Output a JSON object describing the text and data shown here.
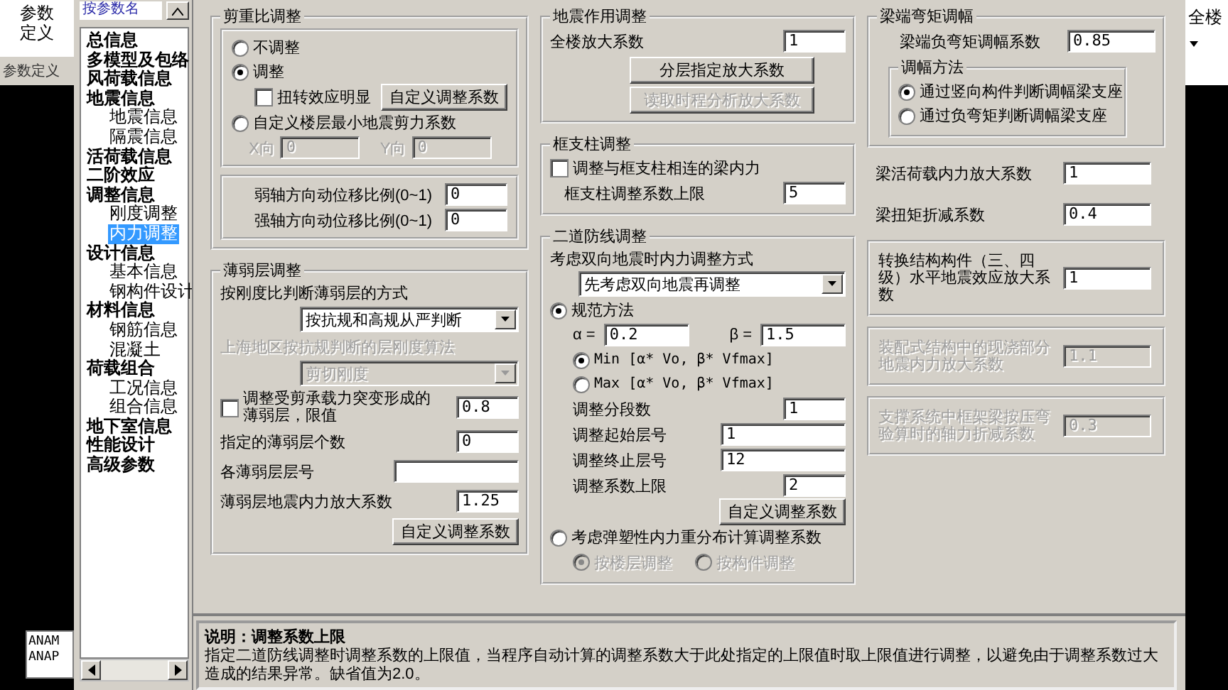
{
  "side": {
    "tab_label": "参数定义",
    "panel_title": "参数定义",
    "console_lines": [
      "ANAM",
      "ANAP"
    ]
  },
  "search": {
    "placeholder": "按参数名"
  },
  "tree": [
    {
      "label": "总信息",
      "selected": false
    },
    {
      "label": "多模型及包络",
      "selected": false
    },
    {
      "label": "风荷载信息",
      "selected": false
    },
    {
      "label": "地震信息",
      "selected": false,
      "children": [
        {
          "label": "地震信息",
          "selected": false
        },
        {
          "label": "隔震信息",
          "selected": false
        }
      ]
    },
    {
      "label": "活荷载信息",
      "selected": false
    },
    {
      "label": "二阶效应",
      "selected": false
    },
    {
      "label": "调整信息",
      "selected": false,
      "children": [
        {
          "label": "刚度调整",
          "selected": false
        },
        {
          "label": "内力调整",
          "selected": true
        }
      ]
    },
    {
      "label": "设计信息",
      "selected": false,
      "children": [
        {
          "label": "基本信息",
          "selected": false
        },
        {
          "label": "钢构件设计",
          "selected": false
        }
      ]
    },
    {
      "label": "材料信息",
      "selected": false,
      "children": [
        {
          "label": "钢筋信息",
          "selected": false
        },
        {
          "label": "混凝土",
          "selected": false
        }
      ]
    },
    {
      "label": "荷载组合",
      "selected": false,
      "children": [
        {
          "label": "工况信息",
          "selected": false
        },
        {
          "label": "组合信息",
          "selected": false
        }
      ]
    },
    {
      "label": "地下室信息",
      "selected": false
    },
    {
      "label": "性能设计",
      "selected": false
    },
    {
      "label": "高级参数",
      "selected": false
    }
  ],
  "shear_ratio": {
    "title": "剪重比调整",
    "options": [
      {
        "label": "不调整",
        "selected": false
      },
      {
        "label": "调整",
        "selected": true
      },
      {
        "label": "自定义楼层最小地震剪力系数",
        "selected": false
      }
    ],
    "torsion": {
      "label": "扭转效应明显",
      "checked": false
    },
    "custom_button": "自定义调整系数",
    "custom_fields": [
      {
        "label": "X向",
        "value": "0",
        "disabled": true
      },
      {
        "label": "Y向",
        "value": "0",
        "disabled": true
      }
    ],
    "ratios": [
      {
        "label": "弱轴方向动位移比例(0~1)",
        "value": "0"
      },
      {
        "label": "强轴方向动位移比例(0~1)",
        "value": "0"
      }
    ]
  },
  "weak_story": {
    "title": "薄弱层调整",
    "method_label": "按刚度比判断薄弱层的方式",
    "method_select": "按抗规和高规从严判断",
    "shanghai_label": {
      "text": "上海地区按抗规判断的层刚度算法",
      "disabled": true
    },
    "shanghai_select": {
      "value": "剪切刚度",
      "disabled": true
    },
    "shear_limit": {
      "label": "调整受剪承载力突变形成的薄弱层，限值",
      "checked": false,
      "value": "0.8"
    },
    "fields": [
      {
        "label": "指定的薄弱层个数",
        "value": "0",
        "kind": "short"
      },
      {
        "label": "各薄弱层层号",
        "kind": "long"
      },
      {
        "label": "薄弱层地震内力放大系数",
        "value": "1.25",
        "kind": "short"
      }
    ],
    "custom_button": "自定义调整系数"
  },
  "seismic": {
    "title": "地震作用调整",
    "field": {
      "label": "全楼放大系数",
      "value": "1"
    },
    "buttons": [
      {
        "label": "分层指定放大系数",
        "disabled": false
      },
      {
        "label": "读取时程分析放大系数",
        "disabled": true
      }
    ]
  },
  "frame_column": {
    "title": "框支柱调整",
    "check": {
      "label": "调整与框支柱相连的梁内力",
      "checked": false
    },
    "field": {
      "label": "框支柱调整系数上限",
      "value": "5"
    }
  },
  "second_defense": {
    "title": "二道防线调整",
    "mode_label": "考虑双向地震时内力调整方式",
    "mode_select": "先考虑双向地震再调整",
    "code_method": {
      "label": "规范方法",
      "selected": true
    },
    "alpha": {
      "label": "α =",
      "value": "0.2"
    },
    "beta": {
      "label": "β =",
      "value": "1.5"
    },
    "formula_options": [
      {
        "label": "Min [α* Vo, β* Vfmax]",
        "selected": true
      },
      {
        "label": "Max [α* Vo, β* Vfmax]",
        "selected": false
      }
    ],
    "fields": [
      {
        "label": "调整分段数",
        "value": "1",
        "kind": "short"
      },
      {
        "label": "调整起始层号",
        "value": "1",
        "kind": "long"
      },
      {
        "label": "调整终止层号",
        "value": "12",
        "kind": "long"
      },
      {
        "label": "调整系数上限",
        "value": "2",
        "kind": "short"
      }
    ],
    "custom_button": "自定义调整系数",
    "plastic_method": {
      "label": "考虑弹塑性内力重分布计算调整系数",
      "selected": false
    },
    "plastic_options": [
      {
        "label": "按楼层调整",
        "selected": true,
        "disabled": true
      },
      {
        "label": "按构件调整",
        "selected": false,
        "disabled": true
      }
    ]
  },
  "beam_moment": {
    "title": "梁端弯矩调幅",
    "field": {
      "label": "梁端负弯矩调幅系数",
      "value": "0.85"
    },
    "method_group": {
      "title": "调幅方法",
      "options": [
        {
          "label": "通过竖向构件判断调幅梁支座",
          "selected": true
        },
        {
          "label": "通过负弯矩判断调幅梁支座",
          "selected": false
        }
      ]
    }
  },
  "beam_factors": [
    {
      "label": "梁活荷载内力放大系数",
      "value": "1",
      "kind": "plain",
      "disabled": false
    },
    {
      "label": "梁扭矩折减系数",
      "value": "0.4",
      "kind": "plain",
      "disabled": false
    },
    {
      "label": "转换结构构件（三、四级）水平地震效应放大系数",
      "value": "1",
      "kind": "boxed",
      "disabled": false
    },
    {
      "label": "装配式结构中的现浇部分地震内力放大系数",
      "value": "1.1",
      "kind": "boxed",
      "disabled": true
    },
    {
      "label": "支撑系统中框架梁按压弯验算时的轴力折减系数",
      "value": "0.3",
      "kind": "boxed",
      "disabled": true
    }
  ],
  "help": {
    "title": "说明：调整系数上限",
    "text": "指定二道防线调整时调整系数的上限值，当程序自动计算的调整系数大于此处指定的上限值时取上限值进行调整，以避免由于调整系数过大造成的结果异常。缺省值为2.0。"
  },
  "right_panel": {
    "label": "全楼"
  }
}
